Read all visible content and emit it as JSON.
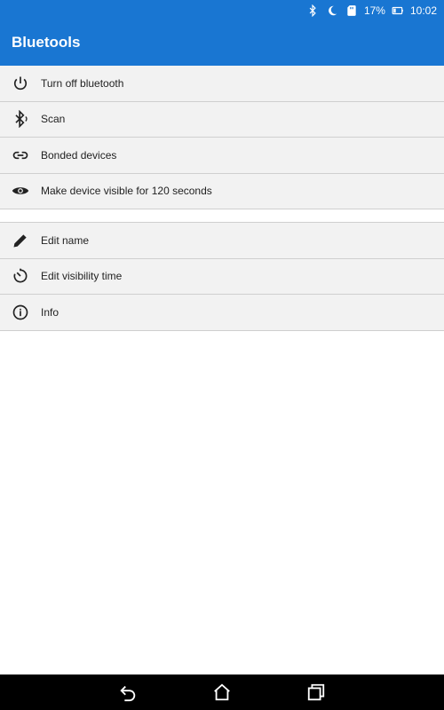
{
  "status_bar": {
    "battery_percent": "17%",
    "time": "10:02",
    "icons": [
      "bluetooth-icon",
      "moon-icon",
      "sd-card-icon",
      "battery-icon"
    ]
  },
  "app_bar": {
    "title": "Bluetools"
  },
  "menu_group_1": [
    {
      "label": "Turn off bluetooth",
      "icon": "power-icon"
    },
    {
      "label": "Scan",
      "icon": "bluetooth-scan-icon"
    },
    {
      "label": "Bonded devices",
      "icon": "link-icon"
    },
    {
      "label": "Make device visible for 120 seconds",
      "icon": "eye-icon"
    }
  ],
  "menu_group_2": [
    {
      "label": "Edit name",
      "icon": "pencil-icon"
    },
    {
      "label": "Edit visibility time",
      "icon": "timer-icon"
    },
    {
      "label": "Info",
      "icon": "info-icon"
    }
  ],
  "nav_bar": {
    "icons": [
      "back-icon",
      "home-icon",
      "recents-icon"
    ]
  },
  "colors": {
    "accent": "#1976d2",
    "list_bg": "#f2f2f2",
    "divider": "#cfcfcf"
  }
}
